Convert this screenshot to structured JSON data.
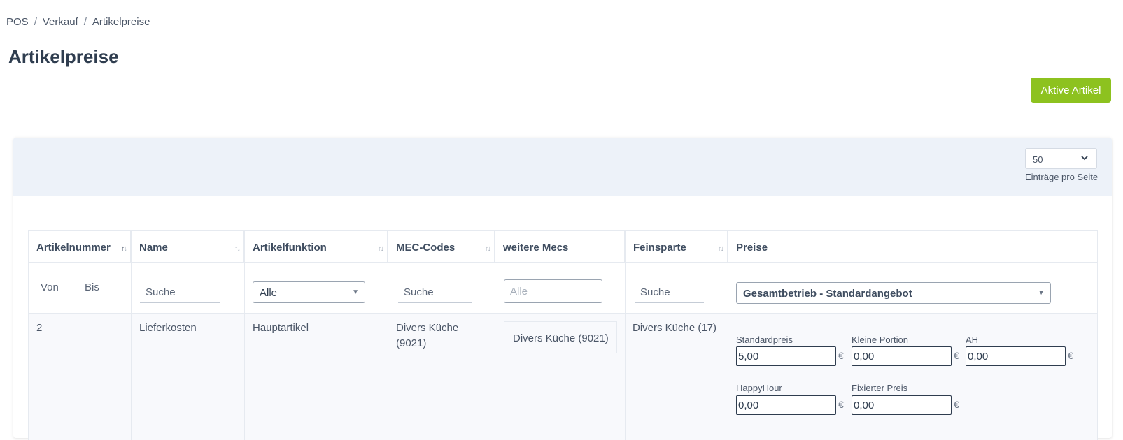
{
  "breadcrumb": {
    "items": [
      "POS",
      "Verkauf",
      "Artikelpreise"
    ],
    "separator": "/"
  },
  "page": {
    "title": "Artikelpreise"
  },
  "toolbar": {
    "active_articles_label": "Aktive Artikel"
  },
  "pagination": {
    "per_page_value": "50",
    "per_page_label": "Einträge pro Seite"
  },
  "table": {
    "columns": [
      "Artikelnummer",
      "Name",
      "Artikelfunktion",
      "MEC-Codes",
      "weitere Mecs",
      "Feinsparte",
      "Preise"
    ],
    "filters": {
      "von_placeholder": "Von",
      "bis_placeholder": "Bis",
      "name_placeholder": "Suche",
      "artikelfunktion_value": "Alle",
      "mec_placeholder": "Suche",
      "weitere_mecs_placeholder": "Alle",
      "feinsparte_placeholder": "Suche",
      "preise_value": "Gesamtbetrieb - Standardangebot"
    },
    "row": {
      "artikelnummer": "2",
      "name": "Lieferkosten",
      "artikelfunktion": "Hauptartikel",
      "mec_codes_line1": "Divers Küche",
      "mec_codes_line2": "(9021)",
      "weitere_mecs": "Divers Küche (9021)",
      "feinsparte": "Divers Küche (17)",
      "prices": {
        "standardpreis_label": "Standardpreis",
        "standardpreis_value": "5,00",
        "kleine_portion_label": "Kleine Portion",
        "kleine_portion_value": "0,00",
        "ah_label": "AH",
        "ah_value": "0,00",
        "happyhour_label": "HappyHour",
        "happyhour_value": "0,00",
        "fixiert_label": "Fixierter Preis",
        "fixiert_value": "0,00",
        "currency": "€"
      }
    }
  },
  "colors": {
    "accent_green": "#8dc21f",
    "header_band": "#edf2f9",
    "text_dark": "#2f3d4f"
  }
}
